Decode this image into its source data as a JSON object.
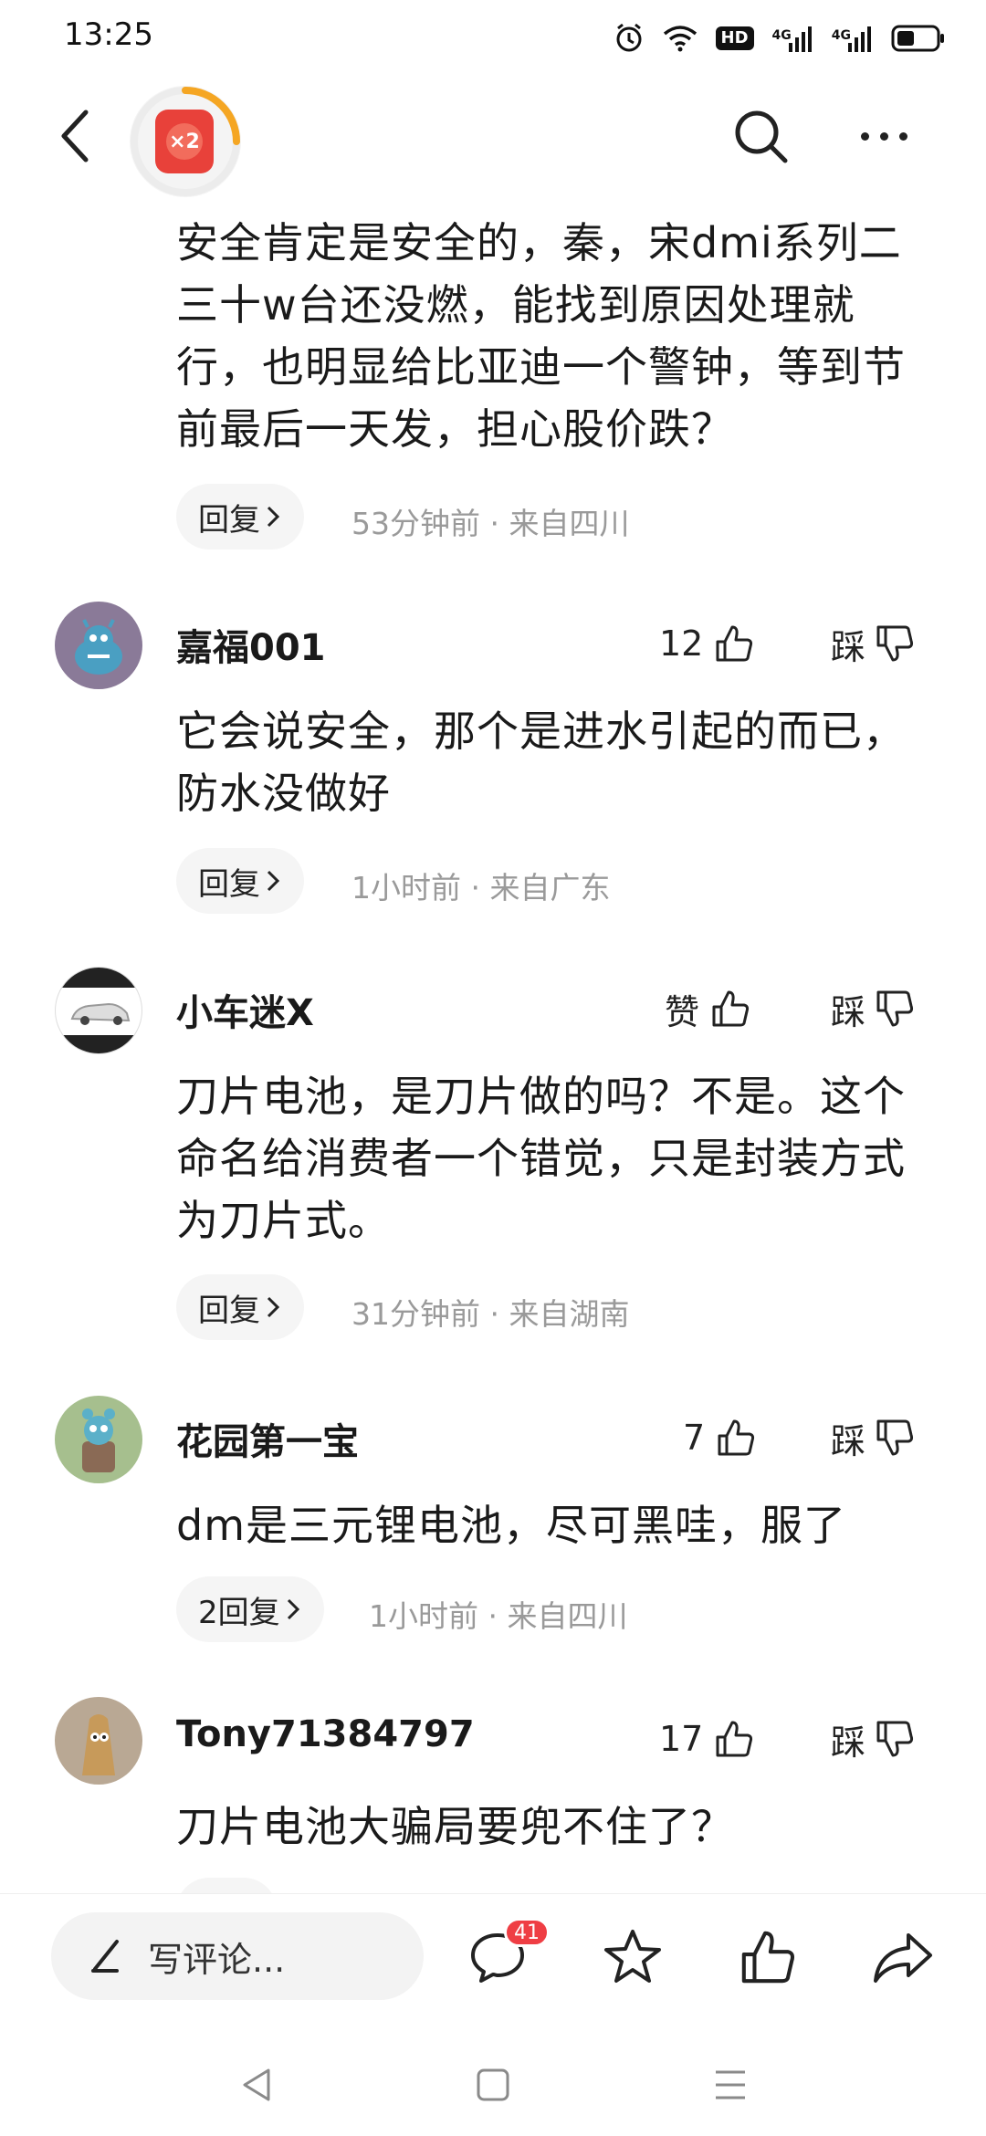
{
  "status_bar": {
    "time": "13:25",
    "hd_label": "HD",
    "signal1_label": "4G",
    "signal2_label": "4G",
    "icons": [
      "alarm-icon",
      "wifi-icon",
      "hd-voice-icon",
      "signal-icon",
      "signal-icon",
      "battery-icon"
    ]
  },
  "top_nav": {
    "back_icon": "back-chevron-icon",
    "red_packet_multiplier": "×2",
    "search_icon": "search-icon",
    "more_icon": "more-icon"
  },
  "comments": [
    {
      "username": "",
      "content": "安全肯定是安全的，秦，宋dmi系列二三十w台还没燃，能找到原因处理就行，也明显给比亚迪一个警钟，等到节前最后一天发，担心股价跌？",
      "reply_label": "回复",
      "time": "53分钟前",
      "location": "来自四川"
    },
    {
      "username": "嘉福001",
      "like_label": "12",
      "dislike_label": "踩",
      "content": "它会说安全，那个是进水引起的而已，防水没做好",
      "reply_label": "回复",
      "time": "1小时前",
      "location": "来自广东"
    },
    {
      "username": "小车迷X",
      "like_label": "赞",
      "dislike_label": "踩",
      "content": "刀片电池，是刀片做的吗？不是。这个命名给消费者一个错觉，只是封装方式为刀片式。",
      "reply_label": "回复",
      "time": "31分钟前",
      "location": "来自湖南"
    },
    {
      "username": "花园第一宝",
      "like_label": "7",
      "dislike_label": "踩",
      "content": "dm是三元锂电池，尽可黑哇，服了",
      "reply_label": "2回复",
      "time": "1小时前",
      "location": "来自四川"
    },
    {
      "username": "Tony71384797",
      "like_label": "17",
      "dislike_label": "踩",
      "content": "刀片电池大骗局要兜不住了？"
    }
  ],
  "bottom_bar": {
    "write_placeholder": "写评论...",
    "comment_count": "41",
    "icons": [
      "pen-icon",
      "comment-icon",
      "star-icon",
      "thumbs-up-icon",
      "share-icon"
    ]
  },
  "system_nav": {
    "icons": [
      "nav-back-icon",
      "nav-home-icon",
      "nav-menu-icon"
    ]
  },
  "colors": {
    "accent_red": "#ef3e44",
    "meta_gray": "#9a9a9a",
    "pill_bg": "#f5f5f5"
  }
}
